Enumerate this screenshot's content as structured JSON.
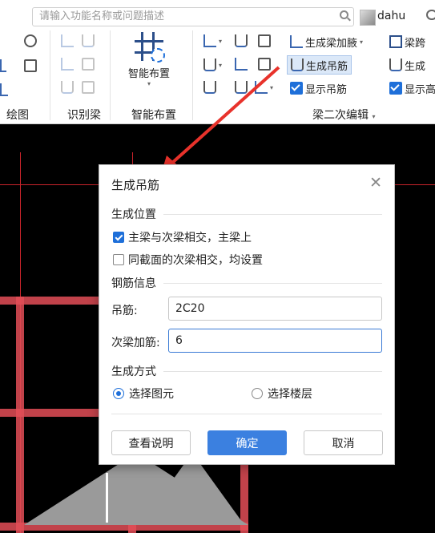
{
  "search": {
    "placeholder": "请输入功能名称或问题描述"
  },
  "user": {
    "name": "dahu"
  },
  "ribbon": {
    "groups": {
      "draw": "绘图",
      "identify_beam": "识别梁",
      "smart_layout": "智能布置",
      "beam_secondary_edit": "梁二次编辑"
    },
    "smart_layout_button": "智能布置",
    "tools": {
      "generate_haunch": "生成梁加腋",
      "beam_span": "梁跨",
      "generate_hanger": "生成吊筋",
      "generate_partial": "生成",
      "show_hanger": "显示吊筋",
      "show_partial": "显示高"
    }
  },
  "dialog": {
    "title": "生成吊筋",
    "section_position": "生成位置",
    "opt_main_secondary": "主梁与次梁相交，主梁上",
    "opt_same_section": "同截面的次梁相交，均设置",
    "section_rebar": "钢筋信息",
    "label_hanger": "吊筋:",
    "value_hanger": "2C20",
    "label_secondary": "次梁加筋:",
    "value_secondary": "6",
    "section_method": "生成方式",
    "radio_select_element": "选择图元",
    "radio_select_floor": "选择楼层",
    "btn_help": "查看说明",
    "btn_ok": "确定",
    "btn_cancel": "取消"
  },
  "colors": {
    "accent": "#3b80e0",
    "beam": "#e34e57",
    "canvas": "#000000"
  }
}
